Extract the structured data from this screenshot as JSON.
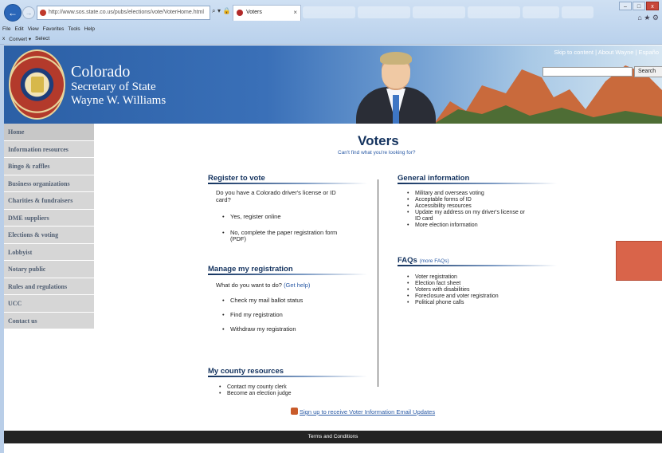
{
  "browser": {
    "address": "http://www.sos.state.co.us/pubs/elections/vote/VoterHome.html",
    "address_tools": "⌕ ▾ 🔒 ↻",
    "active_tab": "Voters",
    "tab_close": "×",
    "background_tabs": [
      "",
      "",
      "",
      "",
      "",
      ""
    ],
    "menu": [
      "File",
      "Edit",
      "View",
      "Favorites",
      "Tools",
      "Help"
    ],
    "command_bar": [
      "x",
      "Convert ▾",
      "Select"
    ],
    "window_controls": [
      "–",
      "□",
      "x"
    ],
    "right_icons": "⌂ ★ ⚙"
  },
  "banner": {
    "org_line1": "Colorado",
    "org_line2": "Secretary of State",
    "org_line3": "Wayne W. Williams",
    "seal_text": "STATE OF COLORADO · 1876",
    "skip_links": "Skip to content  |  About Wayne  |  Españo",
    "search_button": "Search",
    "search_placeholder": ""
  },
  "sidebar": {
    "items": [
      {
        "label": "Home"
      },
      {
        "label": "Information resources"
      },
      {
        "label": "Bingo & raffles"
      },
      {
        "label": "Business organizations"
      },
      {
        "label": "Charities & fundraisers"
      },
      {
        "label": "DME suppliers"
      },
      {
        "label": "Elections & voting"
      },
      {
        "label": "Lobbyist"
      },
      {
        "label": "Notary public"
      },
      {
        "label": "Rules and regulations"
      },
      {
        "label": "UCC"
      },
      {
        "label": "Contact us"
      }
    ]
  },
  "main": {
    "title": "Voters",
    "subtitle": "Can't find what you're looking for?",
    "register": {
      "heading": "Register to vote",
      "question_line1": "Do you have a Colorado driver's license or ID",
      "question_line2": "card?",
      "opt1": "Yes, register online",
      "opt2_line1": "No, complete the paper registration form",
      "opt2_line2": "(PDF)"
    },
    "manage": {
      "heading": "Manage my registration",
      "question": "What do you want to do?",
      "help_link": "(Get help)",
      "items": [
        "Check my mail ballot status",
        "Find my registration",
        "Withdraw my registration"
      ]
    },
    "county": {
      "heading": "My county resources",
      "items": [
        "Contact my county clerk",
        "Become an election judge"
      ]
    },
    "general": {
      "heading": "General information",
      "items": [
        "Military and overseas voting",
        "Acceptable forms of ID",
        "Accessibility resources",
        "Update my address on my driver's license or",
        "More election information"
      ],
      "item4_cont": "ID card"
    },
    "faqs": {
      "heading": "FAQs",
      "more_link": "(more FAQs)",
      "items": [
        "Voter registration",
        "Election fact sheet",
        "Voters with disabilities",
        "Foreclosure and voter registration",
        "Political phone calls"
      ]
    },
    "signup": "Sign up to receive Voter Information Email Updates"
  },
  "footer": {
    "text": "Terms and Conditions"
  }
}
